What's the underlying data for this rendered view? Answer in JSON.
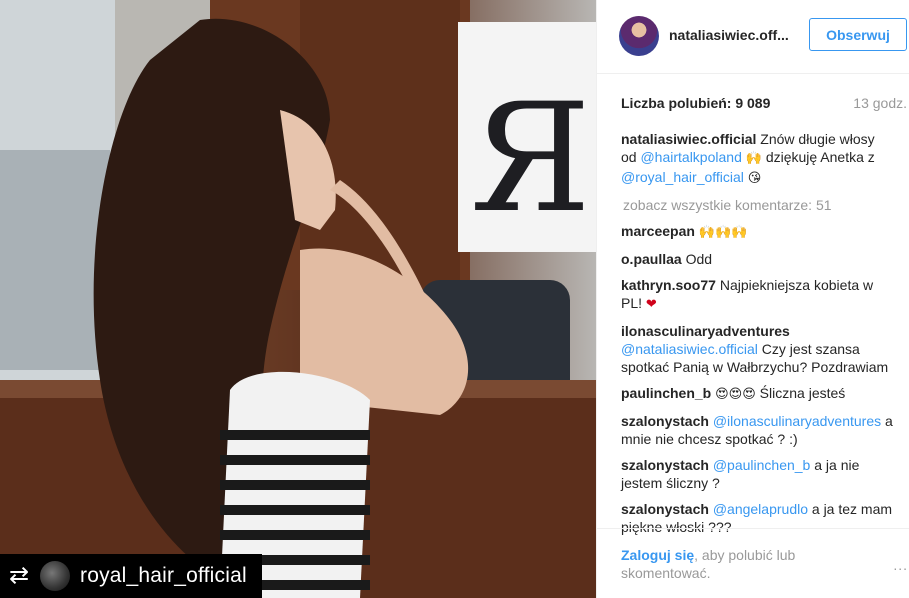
{
  "photo": {
    "repost_username": "royal_hair_official",
    "repost_icon": "repost-icon"
  },
  "post": {
    "author": "nataliasiwiec.off...",
    "follow_label": "Obserwuj",
    "likes": "Liczba polubień: 9 089",
    "time": "13 godz."
  },
  "caption": {
    "user": "nataliasiwiec.official",
    "text1": " Znów długie włosy od ",
    "mention1": "@hairtalkpoland",
    "emoji1": "🙌",
    "text2": " dziękuję Anetka z ",
    "mention2": "@royal_hair_official",
    "emoji2": "😘"
  },
  "view_all": "zobacz wszystkie komentarze: 51",
  "comments": [
    {
      "user": "marceepan",
      "text": "🙌🙌🙌"
    },
    {
      "user": "o.paullaa",
      "text": "Odd"
    },
    {
      "user": "kathryn.soo77",
      "text": "Najpiekniejsza kobieta w PL!",
      "emoji": "❤"
    },
    {
      "user": "ilonasculinaryadventures",
      "mention": "@nataliasiwiec.official",
      "text": " Czy jest szansa spotkać Panią w Wałbrzychu? Pozdrawiam"
    },
    {
      "user": "paulinchen_b",
      "emoji": "😍😍😍",
      "text": " Śliczna jesteś"
    },
    {
      "user": "szalonystach",
      "mention": "@ilonasculinaryadventures",
      "text": " a mnie nie chcesz spotkać ? :)"
    },
    {
      "user": "szalonystach",
      "mention": "@paulinchen_b",
      "text": " a ja nie jestem śliczny ?"
    },
    {
      "user": "szalonystach",
      "mention": "@angelaprudlo",
      "text": " a ja tez mam piękne włoski ???"
    }
  ],
  "footer": {
    "login_link": "Zaloguj się",
    "login_text": ", aby polubić lub skomentować.",
    "more_label": "..."
  }
}
